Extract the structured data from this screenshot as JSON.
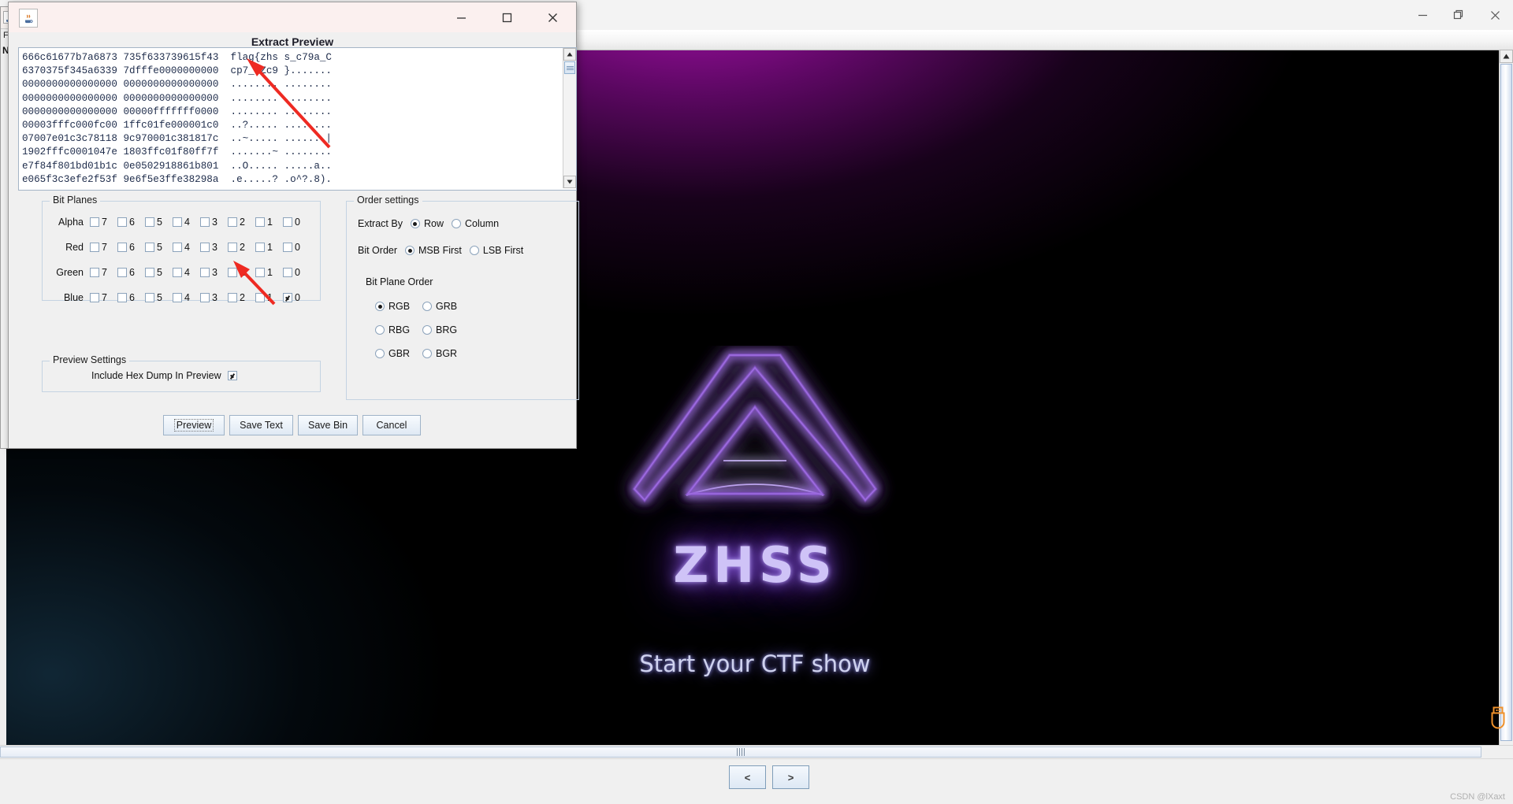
{
  "app_window": {
    "controls": {
      "minimize": "minimize-icon",
      "maximize": "maximize-icon",
      "close": "close-icon"
    },
    "brand": "ZHSS",
    "tagline": "Start your CTF show",
    "nav_prev": "<",
    "nav_next": ">",
    "watermark": "CSDN @lXaxt",
    "usb_icon": "usb-drive-icon"
  },
  "background_window": {
    "menu_letter": "F",
    "row_letter": "N",
    "app_icon": "java-coffee-icon"
  },
  "dialog": {
    "title": "Extract Preview",
    "app_icon": "java-coffee-icon",
    "controls": {
      "minimize": "–",
      "maximize": "□",
      "close": "✕"
    },
    "hex_preview": {
      "lines": [
        "666c61677b7a6873 735f633739615f43  flag{zhs s_c79a_C",
        "6370375f345a6339 7dfffe0000000000  cp7_4Zc9 }.......",
        "0000000000000000 0000000000000000  ........ ........",
        "0000000000000000 0000000000000000  ........ ........",
        "0000000000000000 00000fffffff0000  ........ ........",
        "00003fffc000fc00 1ffc01fe000001c0  ..?..... ........",
        "07007e01c3c78118 9c970001c381817c  ..~..... .......|",
        "1902fffc0001047e 1803ffc01f80ff7f  .......~ ........",
        "e7f84f801bd01b1c 0e0502918861b801  ..O..... .....a..",
        "e065f3c3efe2f53f 9e6f5e3ffe38298a  .e.....? .o^?.8)."
      ]
    },
    "bit_planes": {
      "group_label": "Bit Planes",
      "bit_labels": [
        "7",
        "6",
        "5",
        "4",
        "3",
        "2",
        "1",
        "0"
      ],
      "channels": [
        {
          "name": "Alpha",
          "checked": [
            false,
            false,
            false,
            false,
            false,
            false,
            false,
            false
          ]
        },
        {
          "name": "Red",
          "checked": [
            false,
            false,
            false,
            false,
            false,
            false,
            false,
            false
          ]
        },
        {
          "name": "Green",
          "checked": [
            false,
            false,
            false,
            false,
            false,
            false,
            false,
            false
          ]
        },
        {
          "name": "Blue",
          "checked": [
            false,
            false,
            false,
            false,
            false,
            false,
            false,
            true
          ]
        }
      ]
    },
    "preview_settings": {
      "group_label": "Preview Settings",
      "include_hex_dump_label": "Include Hex Dump In Preview",
      "include_hex_dump_checked": true
    },
    "order_settings": {
      "group_label": "Order settings",
      "extract_by_label": "Extract By",
      "extract_by_options": [
        "Row",
        "Column"
      ],
      "extract_by_selected": "Row",
      "bit_order_label": "Bit Order",
      "bit_order_options": [
        "MSB First",
        "LSB First"
      ],
      "bit_order_selected": "MSB First",
      "bit_plane_order_label": "Bit Plane Order",
      "bit_plane_order_options": [
        "RGB",
        "GRB",
        "RBG",
        "BRG",
        "GBR",
        "BGR"
      ],
      "bit_plane_order_selected": "RGB"
    },
    "buttons": {
      "preview": "Preview",
      "save_text": "Save Text",
      "save_bin": "Save Bin",
      "cancel": "Cancel"
    }
  },
  "annotations": {
    "arrow_color": "#ee2a22",
    "arrow_count": 2
  }
}
